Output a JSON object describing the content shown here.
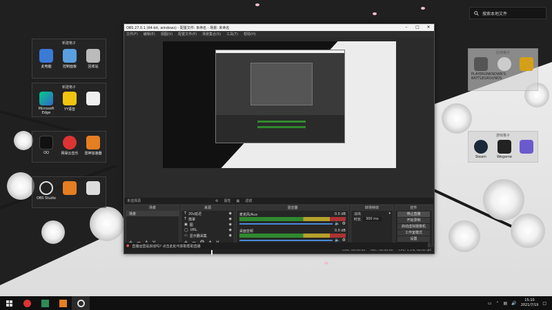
{
  "desktop": {
    "search_label": "搜索本地文件",
    "groups": [
      {
        "title": "新建格子",
        "icons": [
          "此电脑",
          "控制面板",
          "回收站"
        ]
      },
      {
        "title": "新建格子",
        "icons": [
          "Microsoft Edge",
          "YY语音",
          ""
        ]
      },
      {
        "title": "",
        "icons": [
          "QQ",
          "网易云音乐",
          "雷神加速器"
        ]
      },
      {
        "title": "",
        "icons": [
          "OBS Studio",
          "",
          ""
        ]
      },
      {
        "title": "应用格子",
        "icons": [
          "PLAYERUNKNOWN'S BATTLEGROUNDS",
          "",
          ""
        ]
      },
      {
        "title": "游戏格子",
        "icons": [
          "Steam",
          "Wegame",
          ""
        ]
      }
    ]
  },
  "obs": {
    "title": "OBS 27.0.1 (64-bit, windows) - 配置文件: 未命名 - 场景: 未命名",
    "menu": [
      "文件(F)",
      "编辑(E)",
      "视图(V)",
      "配置文件(P)",
      "场景集合(S)",
      "工具(T)",
      "帮助(H)"
    ],
    "source_toolbar": {
      "name": "未选择源",
      "properties": "属性",
      "filters": "滤镜"
    },
    "docks": {
      "scenes": {
        "header": "场景",
        "items": [
          "场景"
        ]
      },
      "sources": {
        "header": "来源",
        "items": [
          "20s延迟",
          "鼓掌",
          "图",
          "URL",
          "显示器采集"
        ]
      },
      "mixer": {
        "header": "混音器",
        "tracks": [
          {
            "name": "麦克风/Aux",
            "db": "0.0 dB"
          },
          {
            "name": "桌面音频",
            "db": "0.0 dB"
          }
        ]
      },
      "transitions": {
        "header": "转场特效",
        "type": "淡出",
        "duration_label": "时长",
        "duration": "300 ms"
      },
      "controls": {
        "header": "控件",
        "buttons": [
          "停止直播",
          "开始录制",
          "启动虚拟摄像机",
          "工作室模式",
          "设置",
          "退出"
        ]
      }
    },
    "status": {
      "live": "LIVE: 00:00:00",
      "rec": "REC: 00:00:00",
      "cpu": "CPU: 1.1%, 60.00 fps"
    },
    "notice": "直播运营是启动吗? 点击此处可获取帮助直播"
  },
  "taskbar": {
    "time": "15:10",
    "date": "2021/7/19"
  },
  "colors": {
    "wall_dark": "#202020",
    "wall_light": "#ececec",
    "obs_bg": "#2b2b2b",
    "accent_blue": "#4a8ad8"
  }
}
